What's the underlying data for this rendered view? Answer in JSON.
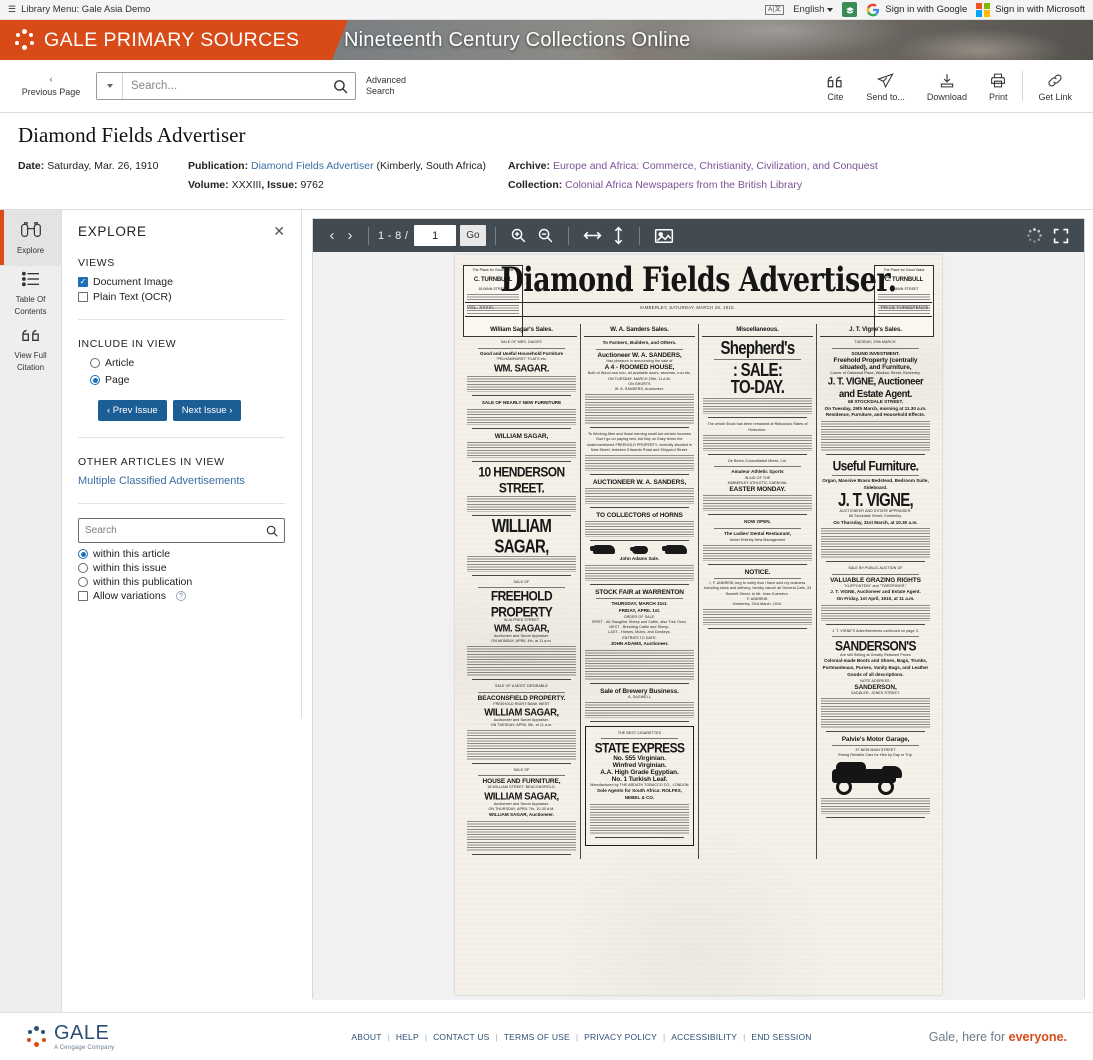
{
  "utility": {
    "library_menu": "Library Menu: Gale Asia Demo",
    "hamburger_icon": "hamburger-icon",
    "language": "English",
    "lang_box_label": "A|文",
    "signin_google": "Sign in with Google",
    "signin_microsoft": "Sign in with Microsoft"
  },
  "banner": {
    "brand": "GALE PRIMARY SOURCES",
    "product_title": "Nineteenth Century Collections Online"
  },
  "nav": {
    "previous_page": "Previous Page",
    "search_placeholder": "Search...",
    "search_value": "",
    "advanced_search": "Advanced\nSearch",
    "advanced_search_line1": "Advanced",
    "advanced_search_line2": "Search",
    "tools": [
      {
        "label": "Cite",
        "icon": "quote-icon"
      },
      {
        "label": "Send to...",
        "icon": "paper-plane-icon"
      },
      {
        "label": "Download",
        "icon": "download-icon"
      },
      {
        "label": "Print",
        "icon": "printer-icon"
      },
      {
        "label": "Get Link",
        "icon": "link-icon"
      }
    ]
  },
  "document": {
    "title": "Diamond Fields Advertiser",
    "date_label": "Date:",
    "date_value": "Saturday,  Mar. 26, 1910",
    "publication_label": "Publication:",
    "publication_value": "Diamond Fields Advertiser",
    "publication_place": "(Kimberly, South Africa)",
    "volume_label": "Volume:",
    "volume_value": "XXXIII",
    "issue_label": ", Issue:",
    "issue_value": "9762",
    "archive_label": "Archive:",
    "archive_value": "Europe and Africa: Commerce, Christianity, Civilization, and Conquest",
    "collection_label": "Collection:",
    "collection_value": "Colonial Africa Newspapers from the British Library"
  },
  "rail": [
    {
      "label_line1": "Explore",
      "label_line2": "",
      "icon": "binoculars-icon",
      "active": true
    },
    {
      "label_line1": "Table Of",
      "label_line2": "Contents",
      "icon": "list-icon",
      "active": false
    },
    {
      "label_line1": "View Full",
      "label_line2": "Citation",
      "icon": "quote-icon",
      "active": false
    }
  ],
  "explore": {
    "title": "EXPLORE",
    "close_icon": "close-icon",
    "views_label": "VIEWS",
    "views": [
      {
        "label": "Document Image",
        "checked": true
      },
      {
        "label": "Plain Text (OCR)",
        "checked": false
      }
    ],
    "include_label": "INCLUDE IN VIEW",
    "include_options": [
      {
        "label": "Article",
        "selected": false
      },
      {
        "label": "Page",
        "selected": true
      }
    ],
    "prev_issue": "‹ Prev Issue",
    "next_issue": "Next Issue ›",
    "other_articles_label": "OTHER ARTICLES IN VIEW",
    "other_articles": [
      "Multiple Classified Advertisements"
    ],
    "search_placeholder": "Search",
    "search_value": "",
    "scope_options": [
      {
        "label": "within this article",
        "selected": true
      },
      {
        "label": "within this issue",
        "selected": false
      },
      {
        "label": "within this publication",
        "selected": false
      }
    ],
    "allow_variations": {
      "label": "Allow variations",
      "checked": false,
      "help_icon": "help-icon"
    }
  },
  "viewer": {
    "prev_icon": "chevron-left-icon",
    "next_icon": "chevron-right-icon",
    "page_range": "1 - 8 /",
    "page_value": "1",
    "go_label": "Go",
    "zoom_in_icon": "zoom-in-icon",
    "zoom_out_icon": "zoom-out-icon",
    "fit_width_icon": "fit-width-icon",
    "fit_height_icon": "fit-height-icon",
    "image_icon": "image-icon",
    "loading_icon": "loading-spinner-icon",
    "fullscreen_icon": "fullscreen-icon"
  },
  "newspaper": {
    "masthead_title": "Diamond Fields Advertiser.",
    "mast_left": "VOL. XXXIII.",
    "mast_center": "KIMBERLEY, SATURDAY, MARCH 26, 1910.",
    "mast_right": "PRICE THREEPENCE.",
    "corner_ad_left": {
      "top": "The Place for Good Value",
      "name": "C. TURNBULL",
      "sub": "18 MAIN STREET"
    },
    "corner_ad_right": {
      "top": "The Place for Good Value",
      "name": "C. TURNBULL",
      "sub": "18 MAIN STREET"
    },
    "columns": [
      {
        "head": "William Sagar's Sales.",
        "ads": [
          {
            "lines": [
              {
                "text": "SALE OF MRS. DAVIES'",
                "size": "t-xs"
              },
              {
                "text": "Good and Useful Household Furniture",
                "size": "t-sm"
              },
              {
                "text": "\"PELHAMHURST\" FLATS etc.",
                "size": "t-xs"
              },
              {
                "text": "WM. SAGAR.",
                "size": "t-lg"
              }
            ]
          },
          {
            "lines": [
              {
                "text": "SALE OF NEARLY NEW FURNITURE",
                "size": "t-sm"
              }
            ]
          },
          {
            "lines": [
              {
                "text": "WILLIAM SAGAR,",
                "size": "t-md"
              }
            ]
          },
          {
            "lines": [
              {
                "text": "10 HENDERSON STREET.",
                "size": "t-xl"
              }
            ]
          },
          {
            "lines": [
              {
                "text": "WILLIAM SAGAR,",
                "size": "t-huge"
              }
            ]
          },
          {
            "lines": [
              {
                "text": "SALE OF",
                "size": "t-xs"
              },
              {
                "text": "FREEHOLD PROPERTY",
                "size": "t-xl"
              },
              {
                "text": "IN ALFRED STREET",
                "size": "t-xs"
              },
              {
                "text": "WM. SAGAR,",
                "size": "t-lg"
              },
              {
                "text": "Auctioneer and Sworn Appraiser.",
                "size": "t-xs"
              },
              {
                "text": "ON MONDAY, APRIL 4th, at 11 a.m.",
                "size": "t-xs"
              }
            ]
          },
          {
            "lines": [
              {
                "text": "SALE OF A MOST DESIRABLE",
                "size": "t-xs"
              },
              {
                "text": "BEACONSFIELD PROPERTY.",
                "size": "t-md"
              },
              {
                "text": "FREEHOLD   RIGHT BANK WEST",
                "size": "t-xs"
              },
              {
                "text": "WILLIAM SAGAR,",
                "size": "t-lg"
              },
              {
                "text": "Auctioneer and Sworn Appraiser.",
                "size": "t-xs"
              },
              {
                "text": "ON TUESDAY, APRIL 5th, at 11 a.m.",
                "size": "t-xs"
              }
            ]
          },
          {
            "lines": [
              {
                "text": "SALE OF",
                "size": "t-xs"
              },
              {
                "text": "HOUSE AND FURNITURE,",
                "size": "t-md"
              },
              {
                "text": "18 WILLIAM STREET, BEACONSFIELD.",
                "size": "t-xs"
              },
              {
                "text": "WILLIAM SAGAR,",
                "size": "t-lg"
              },
              {
                "text": "Auctioneer and Sworn Appraiser.",
                "size": "t-xs"
              },
              {
                "text": "ON THURSDAY, APRIL 7th, 10.30 A.M.",
                "size": "t-xs"
              },
              {
                "text": "WILLIAM SAGAR, Auctioneer.",
                "size": "t-sm"
              }
            ]
          }
        ]
      },
      {
        "head": "W. A. Sanders Sales.",
        "ads": [
          {
            "lines": [
              {
                "text": "To Farmers, Builders, and Others.",
                "size": "t-sm"
              },
              {
                "text": "Auctioneer W. A. SANDERS,",
                "size": "t-md"
              },
              {
                "text": "Has pleasure in announcing the sale of",
                "size": "t-xs"
              },
              {
                "text": "A 4 - ROOMED HOUSE,",
                "size": "t-md"
              },
              {
                "text": "Built of Wood and Iron, all available doors, windows, iron etc.",
                "size": "t-xs"
              },
              {
                "text": "ON TUESDAY, MARCH 29th, 11 A.M.",
                "size": "t-xs"
              },
              {
                "text": "ON SHORTS",
                "size": "t-xs"
              },
              {
                "text": "W. A. SANDERS, Auctioneer.",
                "size": "t-xs"
              }
            ]
          },
          {
            "lines": [
              {
                "text": "To Working Men and those earning small but certain incomes",
                "size": "t-xs"
              },
              {
                "text": "Don't go on paying rent, but Buy on Easy terms the undermentioned FREEHOLD PROPERTY, centrally situated in New Street, between Edwards Road and Shipperd Street.",
                "size": "t-xs"
              }
            ]
          },
          {
            "lines": [
              {
                "text": "AUCTIONEER W. A. SANDERS,",
                "size": "t-md"
              }
            ]
          },
          {
            "lines": [
              {
                "text": "TO COLLECTORS of HORNS",
                "size": "t-md"
              }
            ]
          },
          {
            "lines": [
              {
                "text": "John Adams Sale.",
                "size": "t-sm"
              }
            ],
            "cattle": true
          },
          {
            "lines": [
              {
                "text": "STOCK FAIR at WARRENTON",
                "size": "t-md"
              },
              {
                "text": "THURSDAY, MARCH 31st.",
                "size": "t-sm"
              },
              {
                "text": "FRIDAY, APRIL 1st.",
                "size": "t-sm"
              },
              {
                "text": "ORDER OF SALE:",
                "size": "t-xs"
              },
              {
                "text": "FIRST - All Slaughter Sheep and Cattle, also Trek Oxen.",
                "size": "t-xs"
              },
              {
                "text": "NEXT - Breeding Cattle and Sheep.",
                "size": "t-xs"
              },
              {
                "text": "LAST - Horses, Mules, and Donkeys.",
                "size": "t-xs"
              },
              {
                "text": "ENTRIES TO DATE:",
                "size": "t-xs"
              },
              {
                "text": "JOHN ADAMS, Auctioneer.",
                "size": "t-sm"
              }
            ]
          },
          {
            "lines": [
              {
                "text": "Sale of Brewery Business.",
                "size": "t-md"
              },
              {
                "text": "A. SAGWELL",
                "size": "t-xs"
              }
            ]
          },
          {
            "boxed": true,
            "lines": [
              {
                "text": "THE BEST CIGARETTES",
                "size": "t-xs"
              },
              {
                "text": "STATE EXPRESS",
                "size": "t-xl"
              },
              {
                "text": "No. 555 Virginian.",
                "size": "t-md"
              },
              {
                "text": "Winfred Virginian.",
                "size": "t-md"
              },
              {
                "text": "A.A. High Grade Egyptian.",
                "size": "t-md"
              },
              {
                "text": "No. 1 Turkish Leaf.",
                "size": "t-md"
              },
              {
                "text": "Manufactured by THE ARDATH TOBACCO CO., LONDON",
                "size": "t-xs"
              },
              {
                "text": "Sole Agents for South Africa: ROLFES, NEBEL & CO.",
                "size": "t-sm"
              }
            ]
          }
        ]
      },
      {
        "head": "Miscellaneous.",
        "ads": [
          {
            "lines": [
              {
                "text": "Shepherd's",
                "size": "t-huge"
              },
              {
                "text": ": SALE:",
                "size": "t-huge"
              },
              {
                "text": "TO-DAY.",
                "size": "t-huge"
              }
            ]
          },
          {
            "lines": [
              {
                "text": "The whole Stock has been remarked at Ridiculous Rates of Reduction.",
                "size": "t-xs"
              }
            ]
          },
          {
            "lines": [
              {
                "text": "De Beers Consolidated Mines, Ltd.",
                "size": "t-xs"
              },
              {
                "text": "Amateur Athletic Sports",
                "size": "t-sm"
              },
              {
                "text": "IN AID OF THE",
                "size": "t-xs"
              },
              {
                "text": "KIMBERLEY ATHLETIC CARNIVAL",
                "size": "t-xs"
              },
              {
                "text": "EASTER MONDAY.",
                "size": "t-md"
              }
            ]
          },
          {
            "lines": [
              {
                "text": "NOW OPEN.",
                "size": "t-sm"
              },
              {
                "text": "The Ladies' Dental Restaurant,",
                "size": "t-sm"
              },
              {
                "text": "Under Entirely New Management",
                "size": "t-xs"
              }
            ]
          },
          {
            "lines": [
              {
                "text": "NOTICE.",
                "size": "t-md"
              },
              {
                "text": "I, F. ANDREW, beg to notify that I have sold my business including stock and delivery, hereby cancel all General Cafe, 33 Barnett Street, to Mr. Jose Guerreiro.",
                "size": "t-xs"
              },
              {
                "text": "F. ANDREW.",
                "size": "t-xs"
              },
              {
                "text": "Kimberley, 23rd March, 1910.",
                "size": "t-xs"
              }
            ]
          }
        ]
      },
      {
        "head": "J. T. Vigne's Sales.",
        "ads": [
          {
            "lines": [
              {
                "text": "TUESDAY, 29th MARCH.",
                "size": "t-xs"
              },
              {
                "text": "SOUND INVESTMENT.",
                "size": "t-sm"
              },
              {
                "text": "Freehold Property (centrally situated), and Furniture,",
                "size": "t-md"
              },
              {
                "text": "Corner of Oakwood Place, Windsor Street, Kimberley.",
                "size": "t-xs"
              },
              {
                "text": "J. T. VIGNE, Auctioneer and Estate Agent.",
                "size": "t-lg"
              },
              {
                "text": "68 STOCKDALE STREET.",
                "size": "t-sm"
              },
              {
                "text": "On Tuesday, 29th March, morning at 11.30 a.m.",
                "size": "t-sm"
              },
              {
                "text": "Residence, Furniture, and Household Effects.",
                "size": "t-sm"
              }
            ]
          },
          {
            "lines": [
              {
                "text": "Useful Furniture.",
                "size": "t-xl"
              },
              {
                "text": "Organ, Massive Brass Bedstead, Bedroom Suite, Sideboard.",
                "size": "t-sm"
              },
              {
                "text": "J. T. VIGNE,",
                "size": "t-huge"
              },
              {
                "text": "AUCTIONEER AND ESTATE APPRAISER.",
                "size": "t-xs"
              },
              {
                "text": "68 Stockdale Street, Kimberley.",
                "size": "t-xs"
              },
              {
                "text": "On Thursday, 31st March, at 10.30 a.m.",
                "size": "t-sm"
              }
            ]
          },
          {
            "lines": [
              {
                "text": "SALE BY PUBLIC AUCTION OF",
                "size": "t-xs"
              },
              {
                "text": "VALUABLE GRAZING RIGHTS",
                "size": "t-md"
              },
              {
                "text": "\"KLIPFONTEIN\" and \"TWEERIVIER.\"",
                "size": "t-xs"
              },
              {
                "text": "J. T. VIGNE, Auctioneer and Estate Agent.",
                "size": "t-sm"
              },
              {
                "text": "On Friday, 1st April, 1910, at 11 a.m.",
                "size": "t-sm"
              }
            ]
          },
          {
            "lines": [
              {
                "text": "J. T. VIGNE'S Advertisements continued on page 3.",
                "size": "t-xs"
              },
              {
                "text": "SANDERSON'S",
                "size": "t-xl"
              },
              {
                "text": "Are still Selling at Greatly Reduced Prices",
                "size": "t-xs"
              },
              {
                "text": "Colonial-made Boots and Shoes, Bags, Trunks, Portmanteaus, Purses, Vanity Bags, and Leather Goods of all descriptions.",
                "size": "t-sm"
              },
              {
                "text": "NOTE ADDRESS:",
                "size": "t-xs"
              },
              {
                "text": "SANDERSON,",
                "size": "t-md"
              },
              {
                "text": "SADDLER, JONES STREET.",
                "size": "t-xs"
              }
            ]
          },
          {
            "motorcar": true,
            "lines": [
              {
                "text": "Palvie's Motor Garage,",
                "size": "t-md"
              },
              {
                "text": "37 NEW MAIN STREET",
                "size": "t-xs"
              },
              {
                "text": "Strong Reliable Cars for Hire by Day or Trip.",
                "size": "t-xs"
              }
            ]
          }
        ]
      }
    ]
  },
  "footer": {
    "brand": "GALE",
    "brand_sub": "A Cengage Company",
    "links": [
      "ABOUT",
      "HELP",
      "CONTACT US",
      "TERMS OF USE",
      "PRIVACY POLICY",
      "ACCESSIBILITY",
      "END SESSION"
    ],
    "tagline_plain": "Gale, here for ",
    "tagline_accent": "everyone."
  },
  "colors": {
    "brand_orange": "#d84a17",
    "link_blue": "#3b6ea5",
    "button_blue": "#1b5e96",
    "toolbar_dark": "#434b52",
    "footer_blue": "#2c4f73"
  }
}
